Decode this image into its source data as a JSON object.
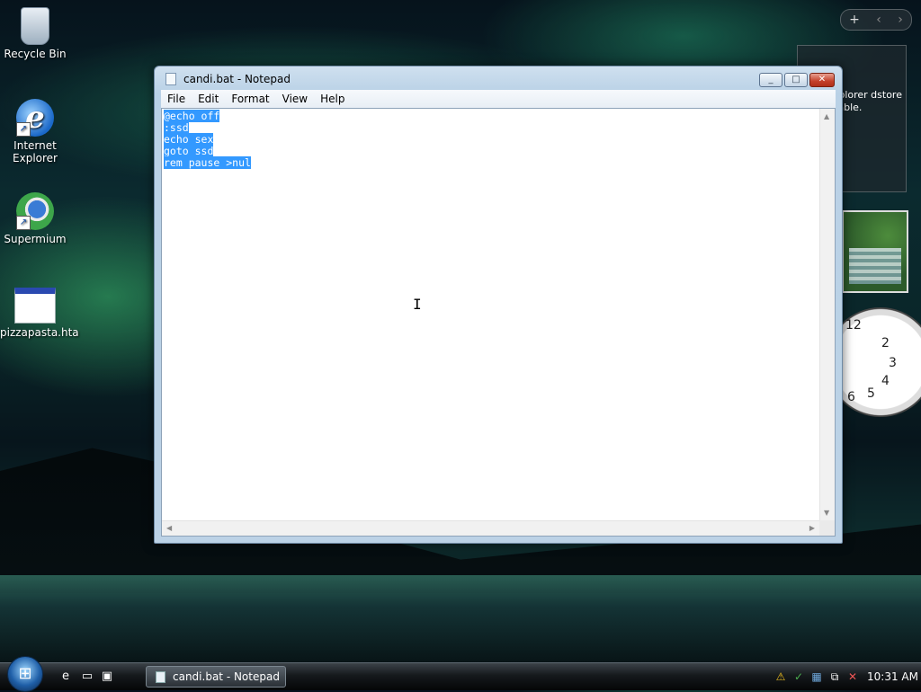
{
  "desktop": {
    "icons": [
      {
        "label": "Recycle Bin"
      },
      {
        "label": "Internet Explorer"
      },
      {
        "label": "Supermium"
      },
      {
        "label": "pizzapasta.hta"
      }
    ],
    "sidebar": {
      "feed_text": "rnet Explorer dstore is available."
    }
  },
  "notepad": {
    "title": "candi.bat - Notepad",
    "menu": [
      "File",
      "Edit",
      "Format",
      "View",
      "Help"
    ],
    "lines": [
      "@echo off",
      ":ssd",
      "echo sex",
      "goto ssd",
      "rem pause >nul"
    ],
    "selection": "all"
  },
  "taskbar": {
    "window_button": "candi.bat - Notepad",
    "clock": "10:31 AM"
  },
  "colors": {
    "selection": "#3399ff",
    "close_button": "#c4402a"
  }
}
